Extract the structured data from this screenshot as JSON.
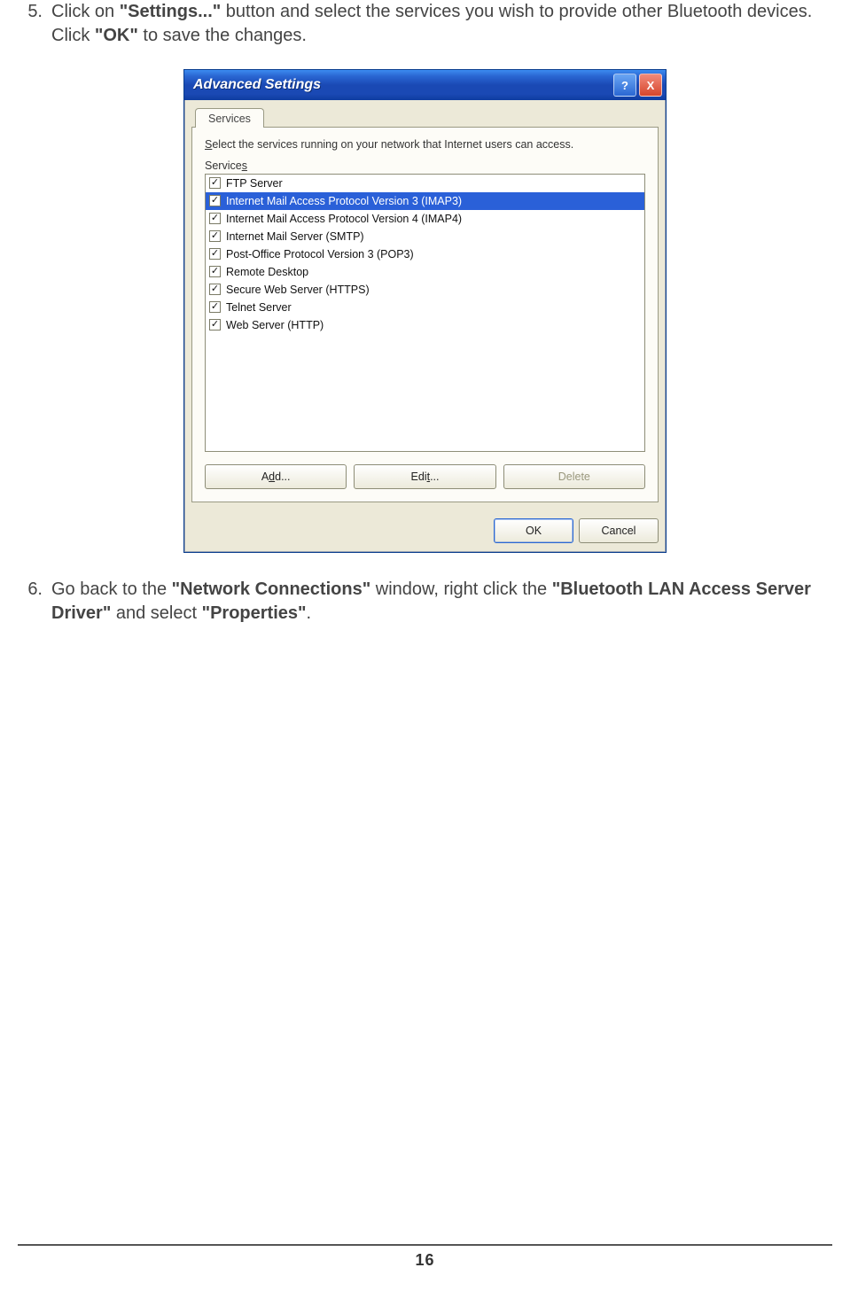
{
  "steps": {
    "s5": {
      "num": "5.",
      "t1": "Click on ",
      "b1": "\"Settings...\"",
      "t2": " button and select the services you wish to provide other Bluetooth devices. Click ",
      "b2": "\"OK\"",
      "t3": " to save the changes."
    },
    "s6": {
      "num": "6.",
      "t1": "Go back to the ",
      "b1": "\"Network Connections\"",
      "t2": " window, right click the ",
      "b2": "\"Bluetooth LAN Access Server Driver\"",
      "t3": " and select ",
      "b3": "\"Properties\"",
      "t4": "."
    }
  },
  "dialog": {
    "title": "Advanced Settings",
    "help": "?",
    "close": "X",
    "tab": "Services",
    "blurb_pre": "S",
    "blurb": "elect the services running on your network that Internet users can access.",
    "list_label_pre": "Service",
    "list_label_u": "s",
    "services": [
      {
        "label": "FTP Server",
        "checked": true,
        "selected": false
      },
      {
        "label": "Internet Mail Access Protocol Version 3 (IMAP3)",
        "checked": true,
        "selected": true
      },
      {
        "label": "Internet Mail Access Protocol Version 4 (IMAP4)",
        "checked": true,
        "selected": false
      },
      {
        "label": "Internet Mail Server (SMTP)",
        "checked": true,
        "selected": false
      },
      {
        "label": "Post-Office Protocol Version 3 (POP3)",
        "checked": true,
        "selected": false
      },
      {
        "label": "Remote Desktop",
        "checked": true,
        "selected": false
      },
      {
        "label": "Secure Web Server (HTTPS)",
        "checked": true,
        "selected": false
      },
      {
        "label": "Telnet Server",
        "checked": true,
        "selected": false
      },
      {
        "label": "Web Server (HTTP)",
        "checked": true,
        "selected": false
      }
    ],
    "buttons": {
      "add_pre": "A",
      "add_u": "d",
      "add_post": "d...",
      "edit_pre": "Edi",
      "edit_u": "t",
      "edit_post": "...",
      "delete": "Delete",
      "ok": "OK",
      "cancel": "Cancel"
    }
  },
  "page_number": "16"
}
